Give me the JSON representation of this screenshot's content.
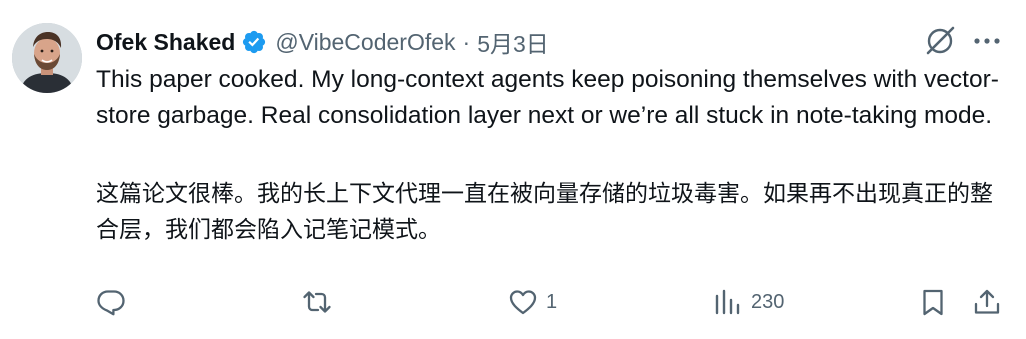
{
  "author": {
    "name": "Ofek Shaked",
    "handle": "@VibeCoderOfek",
    "separator": "·",
    "date": "5月3日",
    "verified": true
  },
  "tweet": {
    "text_en": "This paper cooked. My long-context agents keep poisoning themselves with vector-store garbage. Real consolidation layer next or we’re all stuck in note-taking mode.",
    "text_zh": "这篇论文很棒。我的长上下文代理一直在被向量存储的垃圾毒害。如果再不出现真正的整合层，我们都会陷入记笔记模式。"
  },
  "actions": {
    "reply_count": "",
    "retweet_count": "",
    "like_count": "1",
    "views_count": "230"
  },
  "icons": {
    "verified": "verified-badge-icon",
    "grok": "grok-icon",
    "more": "more-icon",
    "reply": "reply-icon",
    "retweet": "retweet-icon",
    "like": "heart-icon",
    "views": "views-icon",
    "bookmark": "bookmark-icon",
    "share": "share-icon"
  },
  "colors": {
    "text": "#0f1419",
    "secondary": "#536471",
    "verified_blue": "#1d9bf0"
  }
}
